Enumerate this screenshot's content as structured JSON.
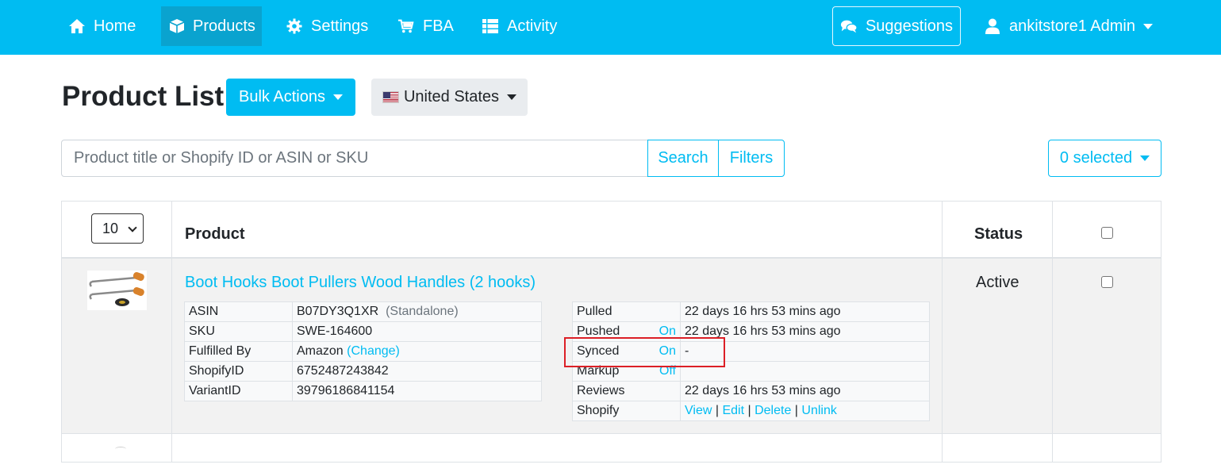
{
  "navbar": {
    "items": [
      {
        "label": "Home",
        "icon": "home-icon"
      },
      {
        "label": "Products",
        "icon": "box-icon"
      },
      {
        "label": "Settings",
        "icon": "gear-icon"
      },
      {
        "label": "FBA",
        "icon": "cart-icon"
      },
      {
        "label": "Activity",
        "icon": "list-icon"
      }
    ],
    "suggestions": {
      "label": "Suggestions",
      "icon": "comments-icon"
    },
    "user": {
      "label": "ankitstore1 Admin",
      "icon": "user-icon"
    },
    "colors": {
      "bar": "#00bcf2",
      "active": "#0aa3cf"
    }
  },
  "header": {
    "title": "Product List",
    "bulk_actions": "Bulk Actions",
    "country": "United States"
  },
  "search": {
    "placeholder": "Product title or Shopify ID or ASIN or SKU",
    "search_label": "Search",
    "filters_label": "Filters",
    "selected_label": "0 selected"
  },
  "table": {
    "per_page": "10",
    "columns": {
      "product": "Product",
      "status": "Status"
    },
    "rows": [
      {
        "title": "Boot Hooks Boot Pullers Wood Handles (2 hooks)",
        "status": "Active",
        "details": {
          "asin_label": "ASIN",
          "asin": "B07DY3Q1XR",
          "asin_note": "(Standalone)",
          "sku_label": "SKU",
          "sku": "SWE-164600",
          "fulfilled_label": "Fulfilled By",
          "fulfilled": "Amazon",
          "fulfilled_change": "(Change)",
          "shopifyid_label": "ShopifyID",
          "shopifyid": "6752487243842",
          "variantid_label": "VariantID",
          "variantid": "39796186841154"
        },
        "sync": {
          "pulled_label": "Pulled",
          "pulled": "22 days 16 hrs 53 mins ago",
          "pushed_label": "Pushed",
          "pushed_toggle": "On",
          "pushed": "22 days 16 hrs 53 mins ago",
          "synced_label": "Synced",
          "synced_toggle": "On",
          "synced": "-",
          "markup_label": "Markup",
          "markup_toggle": "Off",
          "markup": "",
          "reviews_label": "Reviews",
          "reviews": "22 days 16 hrs 53 mins ago",
          "shopify_label": "Shopify",
          "view": "View",
          "edit": "Edit",
          "delete": "Delete",
          "unlink": "Unlink",
          "sep": "|"
        }
      }
    ]
  },
  "accent_color": "#00bcf2",
  "highlight_color": "#dc1f26"
}
